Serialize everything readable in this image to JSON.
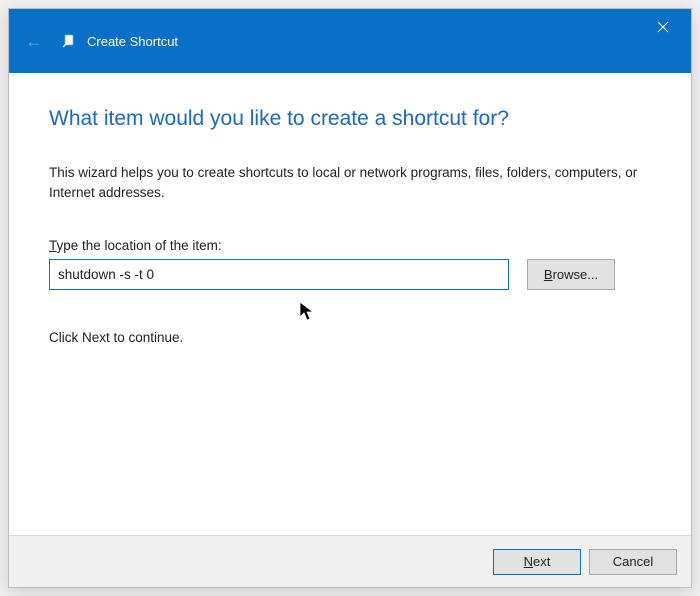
{
  "titlebar": {
    "title": "Create Shortcut"
  },
  "content": {
    "heading": "What item would you like to create a shortcut for?",
    "description": "This wizard helps you to create shortcuts to local or network programs, files, folders, computers, or Internet addresses.",
    "field_label_prefix": "T",
    "field_label_rest": "ype the location of the item:",
    "location_value": "shutdown -s -t 0",
    "browse_prefix": "B",
    "browse_rest": "rowse...",
    "continue_text": "Click Next to continue."
  },
  "footer": {
    "next_prefix": "N",
    "next_rest": "ext",
    "cancel_label": "Cancel"
  },
  "colors": {
    "accent": "#0a6fc7",
    "heading": "#1769c4"
  }
}
